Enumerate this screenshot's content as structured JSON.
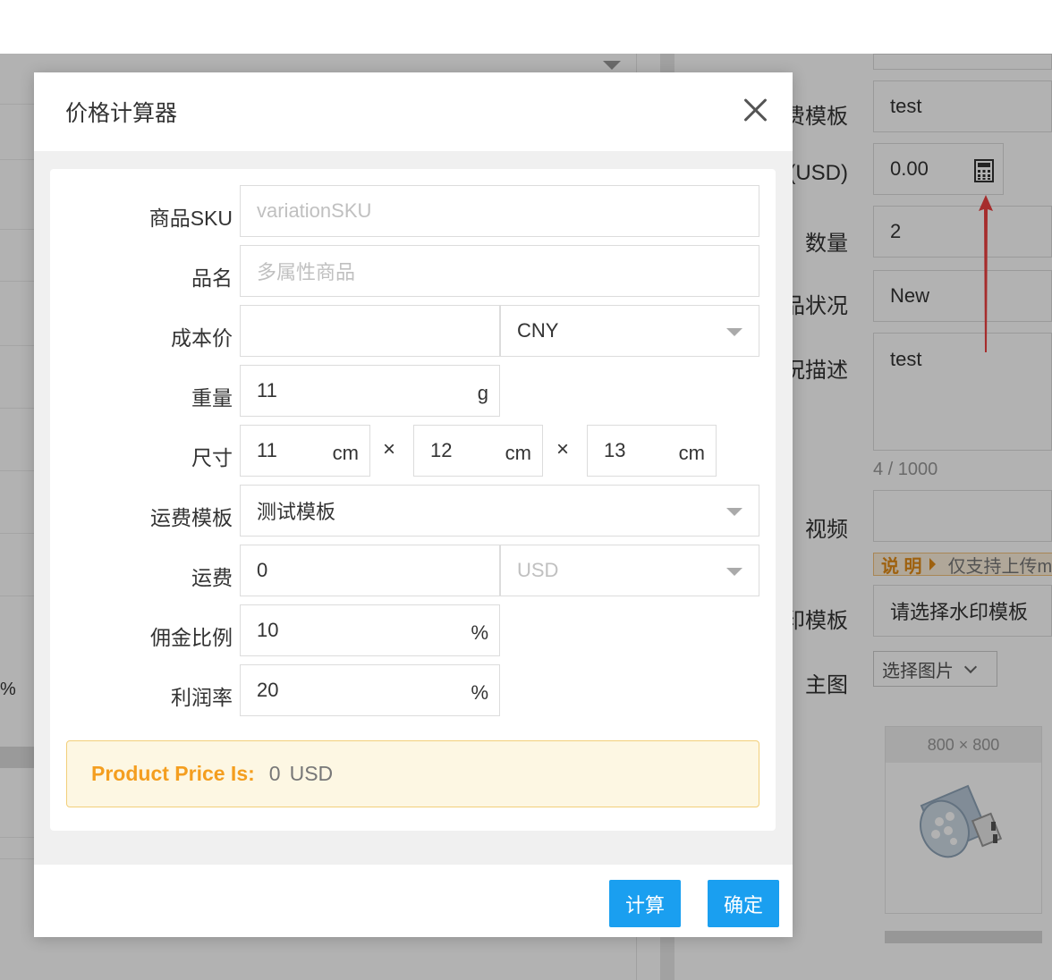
{
  "background": {
    "left_pct": "%",
    "form": {
      "shipping_template_label": "费模板",
      "shipping_template_value": "test",
      "price_label": "(USD)",
      "price_value": "0.00",
      "calculator_icon": "calculator-icon",
      "quantity_label": "数量",
      "quantity_value": "2",
      "condition_label": "品状况",
      "condition_value": "New",
      "condition_desc_label": "况描述",
      "condition_desc_value": "test",
      "counter": "4 / 1000",
      "video_label": "视频",
      "note_key": "说 明",
      "note_text": "仅支持上传m",
      "watermark_label": "印模板",
      "watermark_value": "请选择水印模板",
      "main_image_label": "主图",
      "select_image": "选择图片",
      "image_size": "800 × 800"
    },
    "annotation_arrow_color": "#ee3f3f"
  },
  "modal": {
    "title": "价格计算器",
    "close_icon": "close-icon",
    "fields": {
      "sku": {
        "label": "商品SKU",
        "placeholder": "variationSKU"
      },
      "name": {
        "label": "品名",
        "placeholder": "多属性商品"
      },
      "cost": {
        "label": "成本价",
        "value": "",
        "currency": "CNY"
      },
      "weight": {
        "label": "重量",
        "value": "11",
        "unit": "g"
      },
      "size": {
        "label": "尺寸",
        "length": "11",
        "width": "12",
        "height": "13",
        "unit": "cm",
        "times": "×"
      },
      "shipping_template": {
        "label": "运费模板",
        "value": "测试模板"
      },
      "shipping_fee": {
        "label": "运费",
        "value": "0",
        "currency_placeholder": "USD"
      },
      "commission": {
        "label": "佣金比例",
        "value": "10",
        "unit": "%"
      },
      "profit": {
        "label": "利润率",
        "value": "20",
        "unit": "%"
      }
    },
    "result": {
      "label": "Product Price Is:",
      "value": "0",
      "currency": "USD"
    },
    "buttons": {
      "calculate": "计算",
      "confirm": "确定"
    },
    "colors": {
      "primary": "#1a9ff0",
      "result_label": "#f49e1f",
      "result_bg": "#fdf7e3"
    }
  }
}
